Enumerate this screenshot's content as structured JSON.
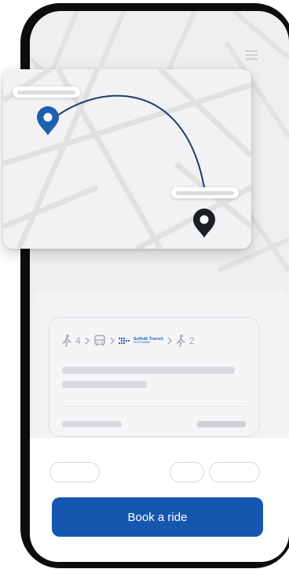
{
  "app": {
    "brand_name": "Suffolk Transit",
    "brand_sub": "ON DEMAND"
  },
  "route": {
    "walk_to_minutes": "4",
    "walk_from_minutes": "2"
  },
  "actions": {
    "book_label": "Book a ride"
  },
  "colors": {
    "accent": "#1557b0",
    "route_line": "#1f3d6b",
    "origin_pin": "#1f5fb0",
    "destination_pin": "#1c1f26"
  },
  "icons": [
    "menu-icon",
    "walk-icon",
    "bus-icon",
    "chevron-right-icon",
    "origin-pin-icon",
    "destination-pin-icon"
  ]
}
